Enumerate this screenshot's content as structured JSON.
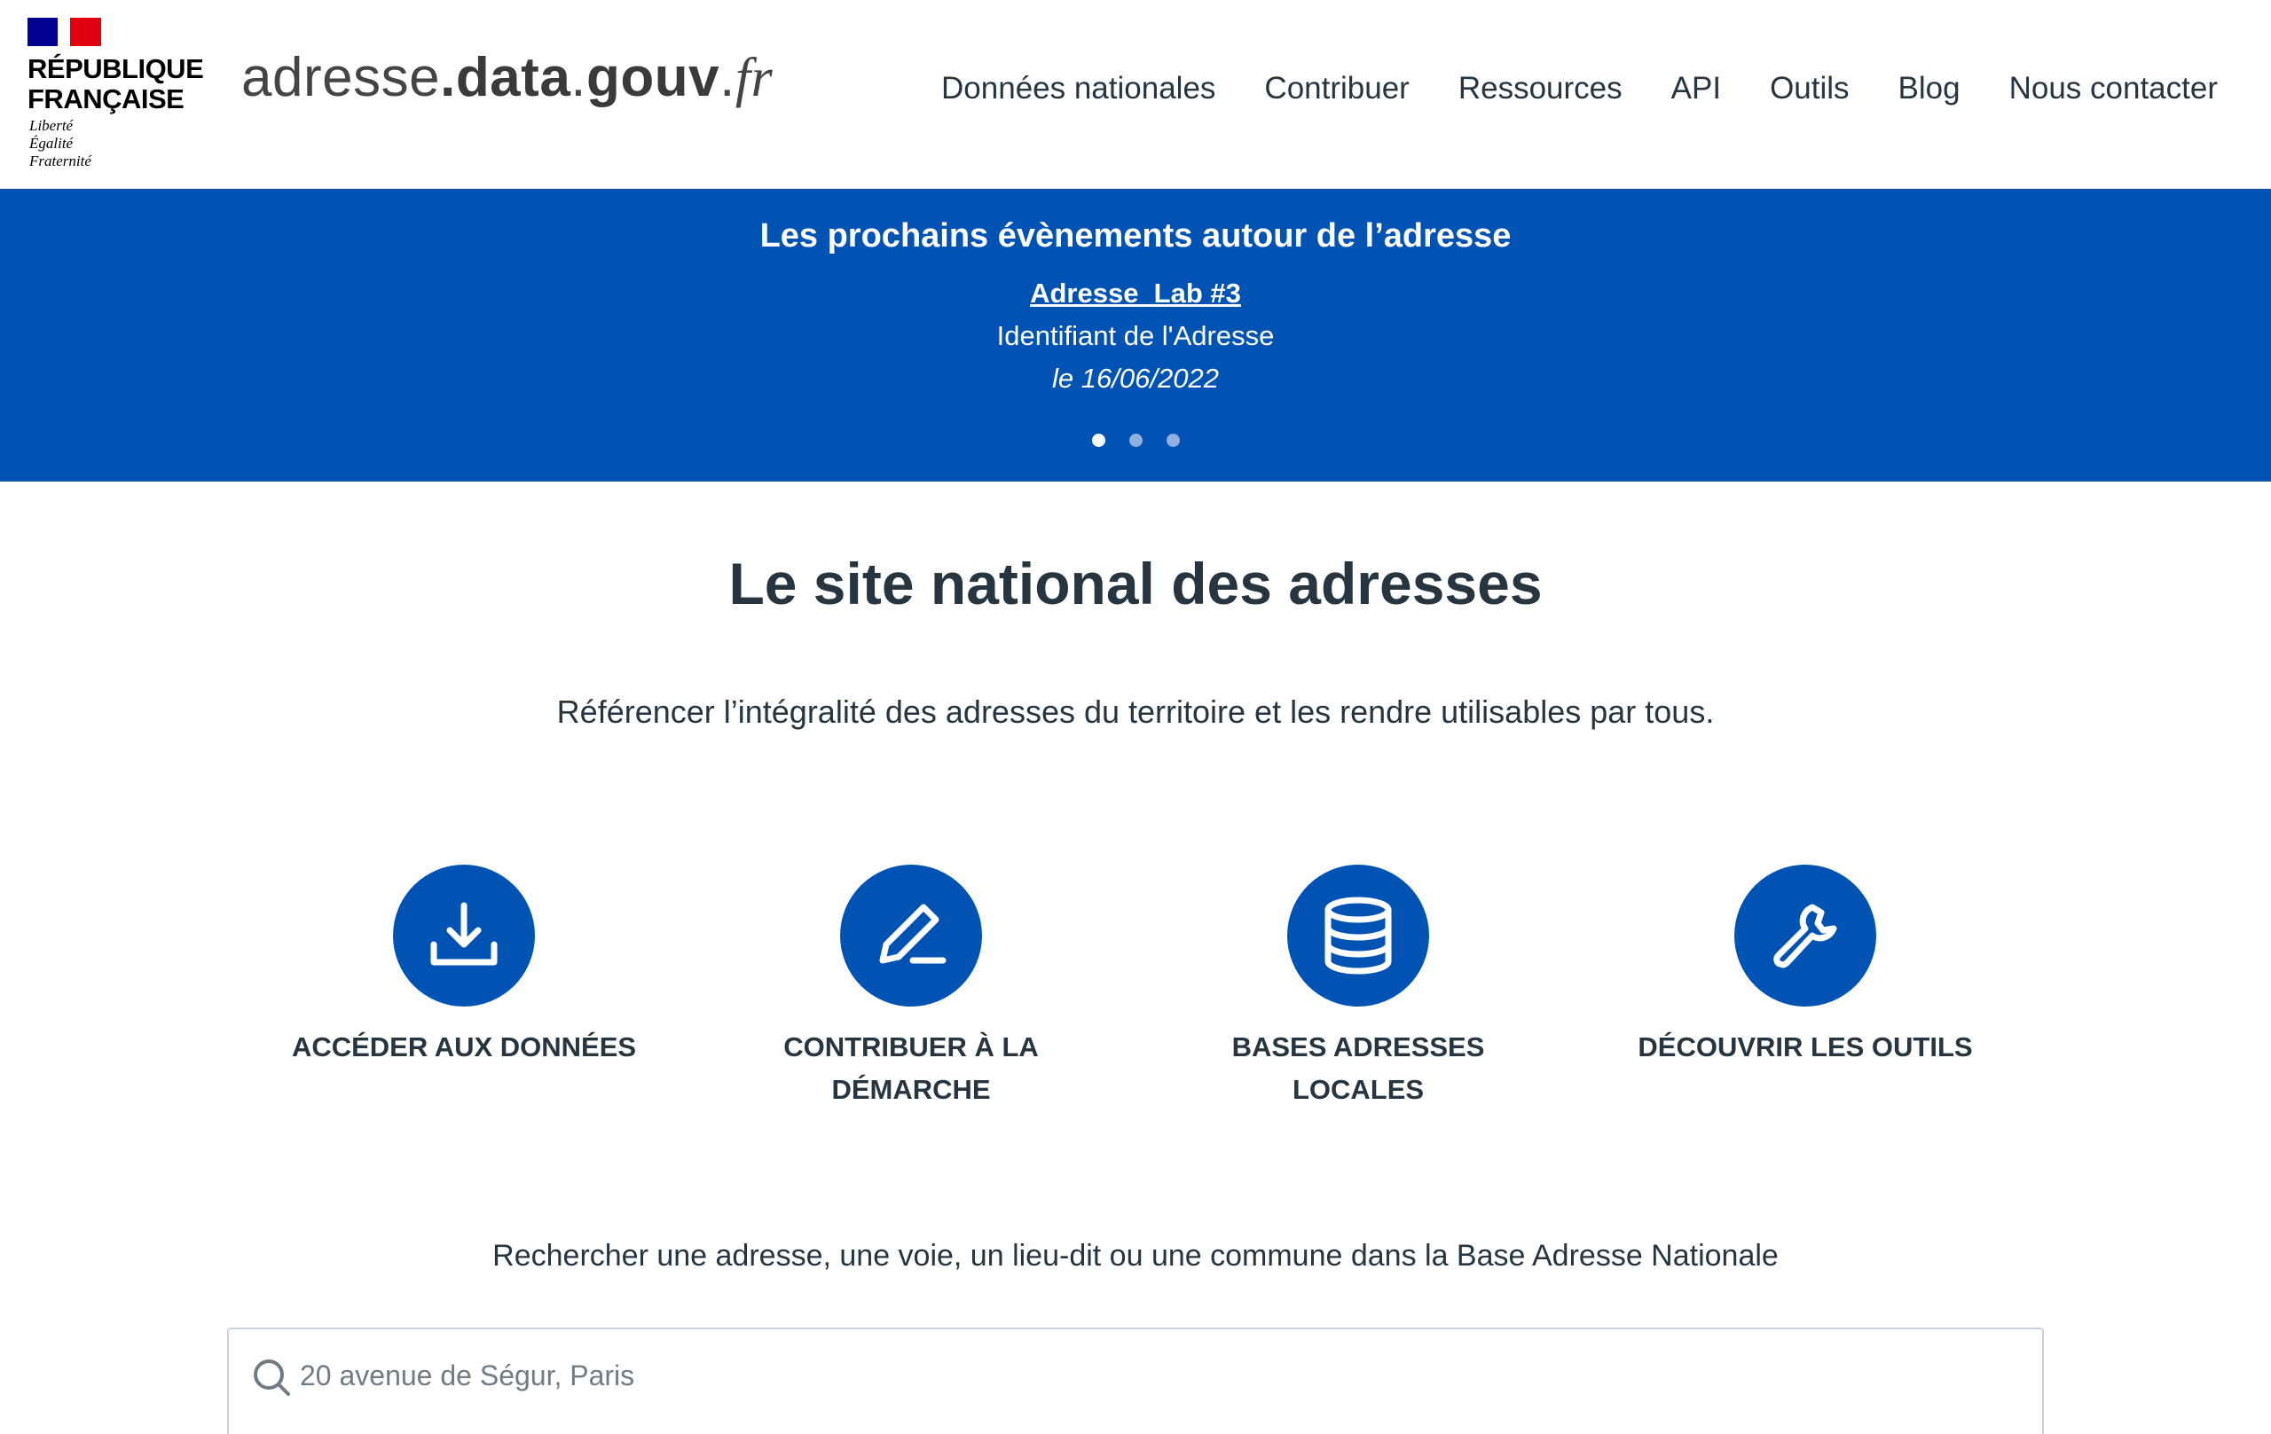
{
  "brand": {
    "republique_line1": "RÉPUBLIQUE",
    "republique_line2": "FRANÇAISE",
    "devise_1": "Liberté",
    "devise_2": "Égalité",
    "devise_3": "Fraternité",
    "site_part1": "adresse",
    "site_part2": ".",
    "site_part3": "data",
    "site_part4": ".",
    "site_part5": "gouv",
    "site_part6": ".",
    "site_part7": "fr",
    "flag_colors": [
      "#000091",
      "#ffffff",
      "#e1000f"
    ]
  },
  "nav": {
    "items": [
      {
        "label": "Données nationales"
      },
      {
        "label": "Contribuer"
      },
      {
        "label": "Ressources"
      },
      {
        "label": "API"
      },
      {
        "label": "Outils"
      },
      {
        "label": "Blog"
      },
      {
        "label": "Nous contacter"
      }
    ]
  },
  "banner": {
    "title": "Les prochains évènements autour de l’adresse",
    "event_link": "Adresse_Lab #3",
    "event_subtitle": "Identifiant de l'Adresse",
    "event_date": "le 16/06/2022",
    "slides_count": 3,
    "active_slide": 1,
    "background": "#0053b3"
  },
  "main": {
    "title": "Le site national des adresses",
    "subtitle": "Référencer l’intégralité des adresses du territoire et les rendre utilisables par tous."
  },
  "features": [
    {
      "label": "Accéder aux données",
      "icon": "download-icon"
    },
    {
      "label": "Contribuer à la démarche",
      "icon": "pencil-icon"
    },
    {
      "label": "Bases adresses locales",
      "icon": "database-icon"
    },
    {
      "label": "Découvrir les outils",
      "icon": "wrench-icon"
    }
  ],
  "search": {
    "caption": "Rechercher une adresse, une voie, un lieu-dit ou une commune dans la Base Adresse Nationale",
    "placeholder": "20 avenue de Ségur, Paris",
    "value": ""
  },
  "colors": {
    "accent": "#0053b3",
    "text": "#26353f"
  }
}
